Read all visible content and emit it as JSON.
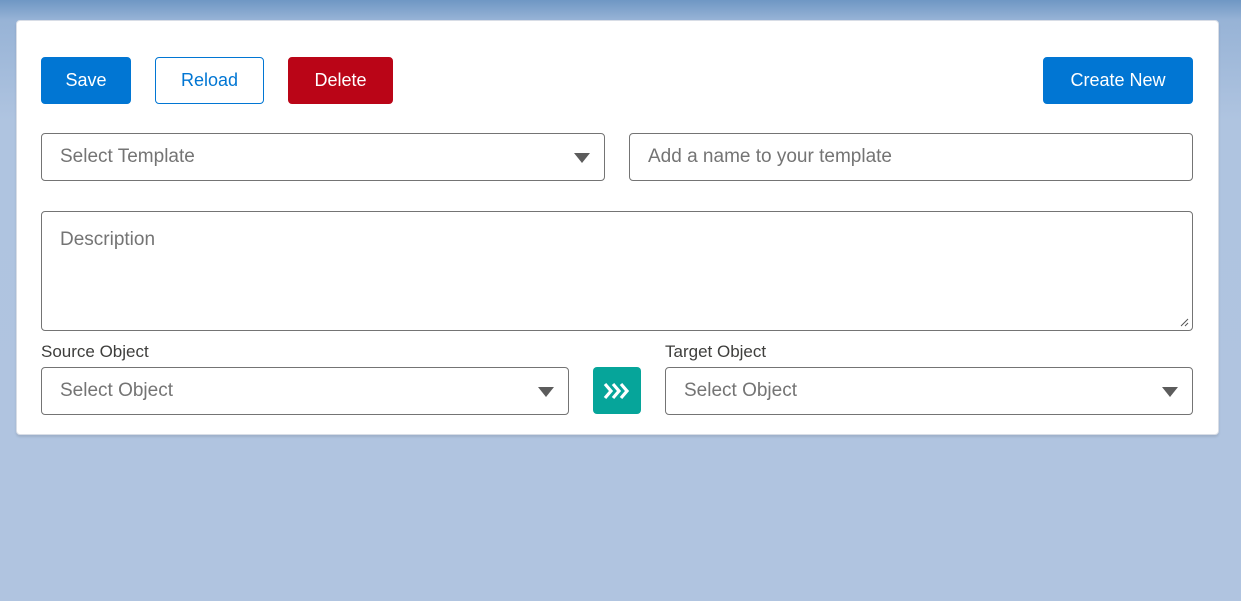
{
  "toolbar": {
    "save_label": "Save",
    "reload_label": "Reload",
    "delete_label": "Delete",
    "create_new_label": "Create New"
  },
  "form": {
    "template_select_placeholder": "Select Template",
    "template_name_placeholder": "Add a name to your template",
    "description_placeholder": "Description",
    "source_object_label": "Source Object",
    "source_object_placeholder": "Select Object",
    "target_object_label": "Target Object",
    "target_object_placeholder": "Select Object",
    "map_icon": "double-chevron-right-icon"
  },
  "colors": {
    "brand": "#0176d3",
    "danger": "#ba0517",
    "accent": "#06a59a"
  }
}
